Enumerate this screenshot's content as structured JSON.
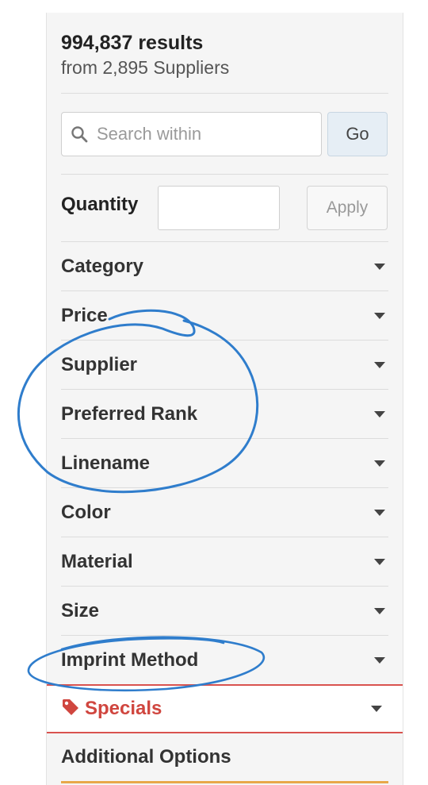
{
  "results": {
    "count": "994,837",
    "count_label": "results",
    "suppliers_text": "from 2,895 Suppliers"
  },
  "search": {
    "placeholder": "Search within",
    "value": "",
    "go_label": "Go"
  },
  "quantity": {
    "label": "Quantity",
    "value": "",
    "apply_label": "Apply"
  },
  "facets": [
    "Category",
    "Price",
    "Supplier",
    "Preferred Rank",
    "Linename",
    "Color",
    "Material",
    "Size",
    "Imprint Method"
  ],
  "specials": {
    "label": "Specials",
    "icon": "tag-icon",
    "color": "#d0463f"
  },
  "additional_options": {
    "label": "Additional Options"
  },
  "annotation_color": "#2f7dcc"
}
